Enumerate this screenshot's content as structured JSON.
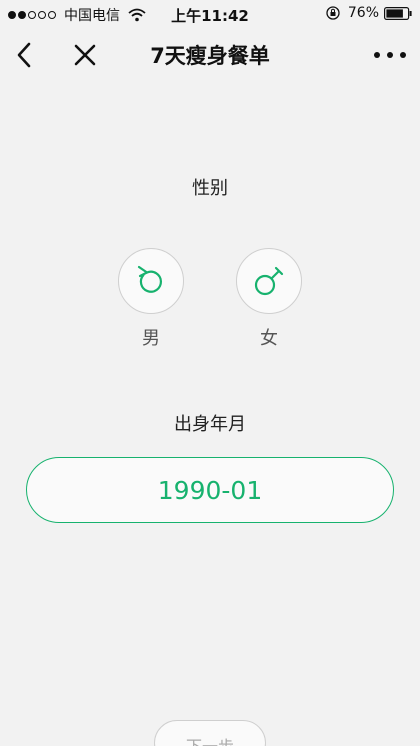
{
  "status_bar": {
    "carrier": "中国电信",
    "time": "上午11:42",
    "battery": "76%",
    "signal_bars": [
      true,
      true,
      false,
      false,
      false
    ]
  },
  "nav": {
    "title": "7天瘦身餐单"
  },
  "gender": {
    "title": "性别",
    "male_label": "男",
    "female_label": "女"
  },
  "birth": {
    "title": "出身年月",
    "value": "1990-01"
  },
  "next_button": {
    "label": "下一步"
  },
  "colors": {
    "accent": "#17b26e",
    "background": "#f2f2f2",
    "border": "#cfcfcf"
  }
}
